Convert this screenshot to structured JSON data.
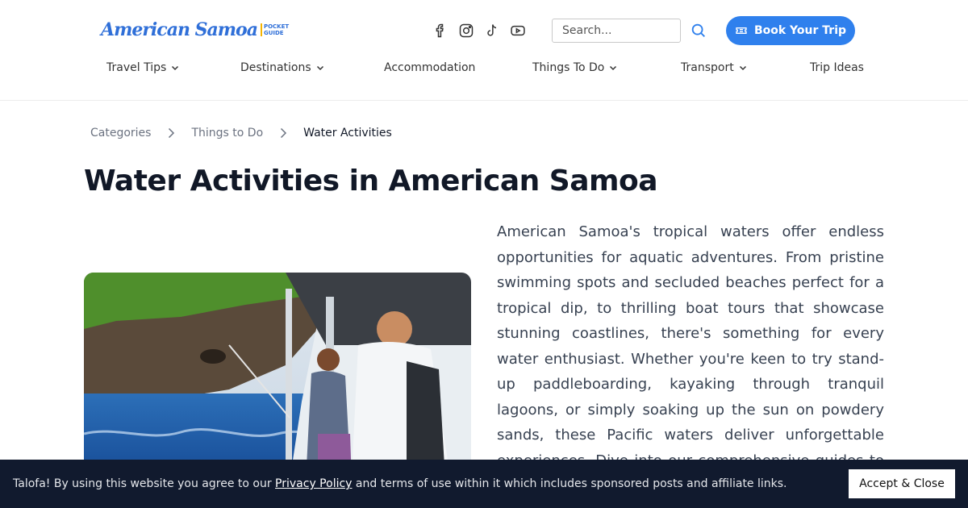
{
  "header": {
    "logo_text": "American Samoa",
    "logo_badge_line1": "POCKET",
    "logo_badge_line2": "GUIDE",
    "socials": [
      "facebook-icon",
      "instagram-icon",
      "tiktok-icon",
      "youtube-icon"
    ],
    "search_placeholder": "Search...",
    "book_label": "Book Your Trip",
    "accent_color": "#2f80ed"
  },
  "nav": {
    "items": [
      {
        "label": "Travel Tips",
        "dropdown": true
      },
      {
        "label": "Destinations",
        "dropdown": true
      },
      {
        "label": "Accommodation",
        "dropdown": false
      },
      {
        "label": "Things To Do",
        "dropdown": true
      },
      {
        "label": "Transport",
        "dropdown": true
      },
      {
        "label": "Trip Ideas",
        "dropdown": false
      }
    ]
  },
  "breadcrumb": {
    "items": [
      "Categories",
      "Things to Do",
      "Water Activities"
    ]
  },
  "main": {
    "title": "Water Activities in American Samoa",
    "intro": "American Samoa's tropical waters offer endless opportunities for aquatic adventures. From pristine swimming spots and secluded beaches perfect for a tropical dip, to thrilling boat tours that showcase stunning coastlines, there's something for every water enthusiast. Whether you're keen to try stand-up paddleboarding, kayaking through tranquil lagoons, or simply soaking up the sun on powdery sands, these Pacific waters deliver unforgettable experiences. Dive into our comprehensive guides to discover the best"
  },
  "cookie": {
    "text_before": "Talofa! By using this website you agree to our ",
    "link": "Privacy Policy",
    "text_after": " and terms of use within it which includes sponsored posts and affiliate links.",
    "accept_label": "Accept & Close"
  }
}
